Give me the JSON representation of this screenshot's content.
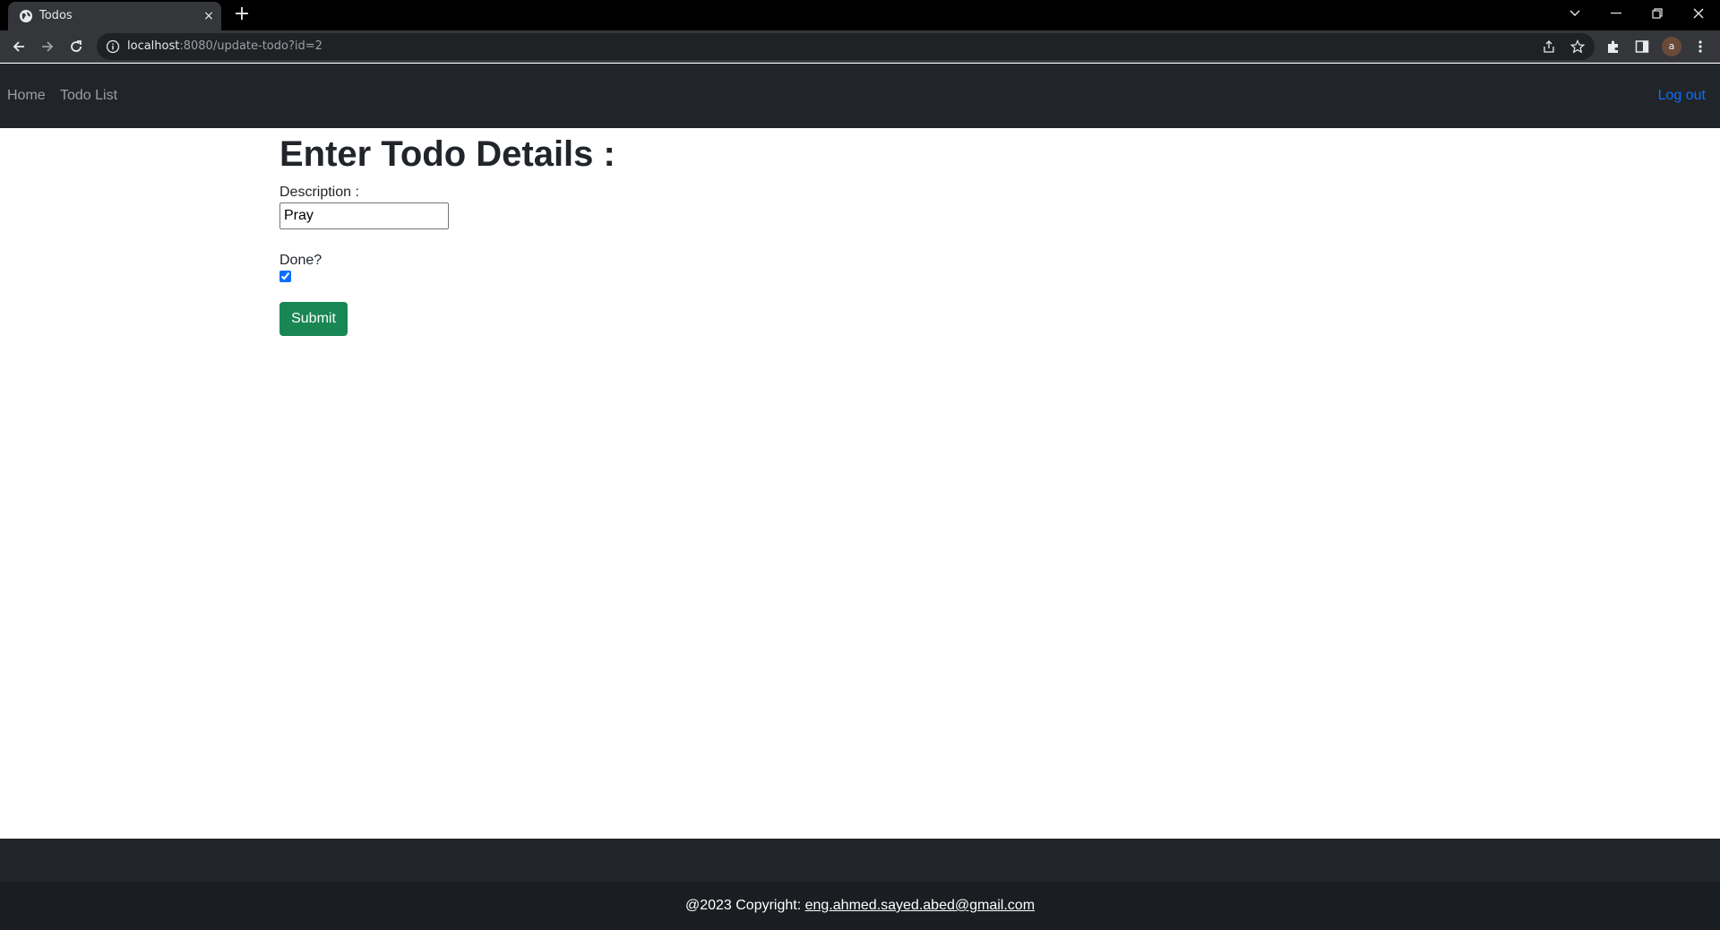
{
  "browser": {
    "tab_title": "Todos",
    "tab_close": "×",
    "new_tab": "+",
    "url_host": "localhost",
    "url_rest": ":8080/update-todo?id=2",
    "profile_initial": "a"
  },
  "navbar": {
    "home": "Home",
    "todo_list": "Todo List",
    "logout": "Log out"
  },
  "form": {
    "title": "Enter Todo Details :",
    "description_label": "Description :",
    "description_value": "Pray",
    "done_label": "Done?",
    "done_checked": true,
    "submit_label": "Submit"
  },
  "footer": {
    "copyright": "@2023 Copyright: ",
    "email": "eng.ahmed.sayed.abed@gmail.com"
  },
  "colors": {
    "navbar_bg": "#212529",
    "link_primary": "#0d6efd",
    "submit_bg": "#198754"
  }
}
